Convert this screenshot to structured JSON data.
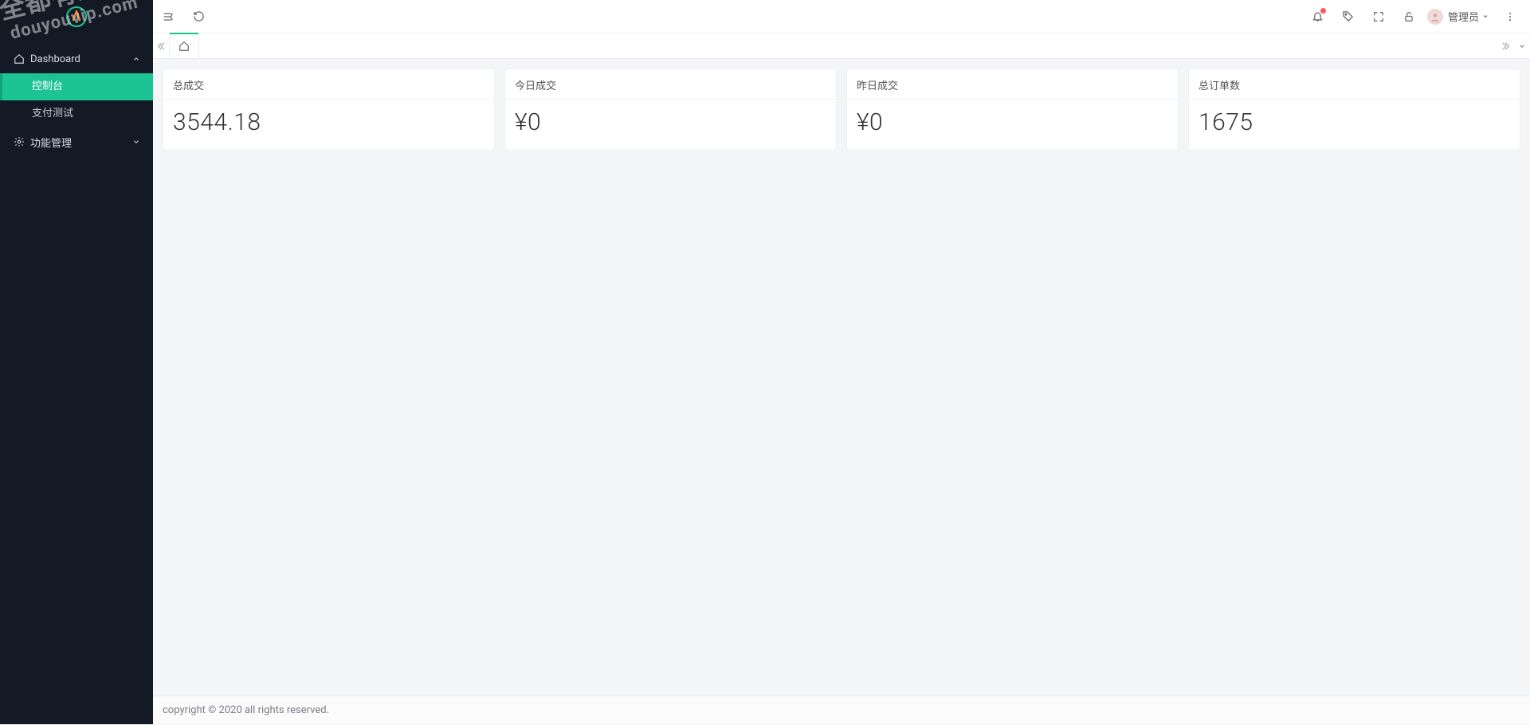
{
  "watermark": {
    "line1": "全都有综合资源网",
    "line2": "douyouvip.com"
  },
  "sidebar": {
    "menu": [
      {
        "label": "Dashboard",
        "icon": "home-icon",
        "expanded": true,
        "children": [
          {
            "label": "控制台",
            "active": true
          },
          {
            "label": "支付测试",
            "active": false
          }
        ]
      },
      {
        "label": "功能管理",
        "icon": "gear-icon",
        "expanded": false
      }
    ]
  },
  "topbar": {
    "user_name": "管理员",
    "notification_dot": true
  },
  "tabs": {
    "home_active": true
  },
  "cards": [
    {
      "title": "总成交",
      "value": "3544.18"
    },
    {
      "title": "今日成交",
      "value": "¥0"
    },
    {
      "title": "昨日成交",
      "value": "¥0"
    },
    {
      "title": "总订单数",
      "value": "1675"
    }
  ],
  "footer": {
    "text": "copyright © 2020 all rights reserved."
  }
}
